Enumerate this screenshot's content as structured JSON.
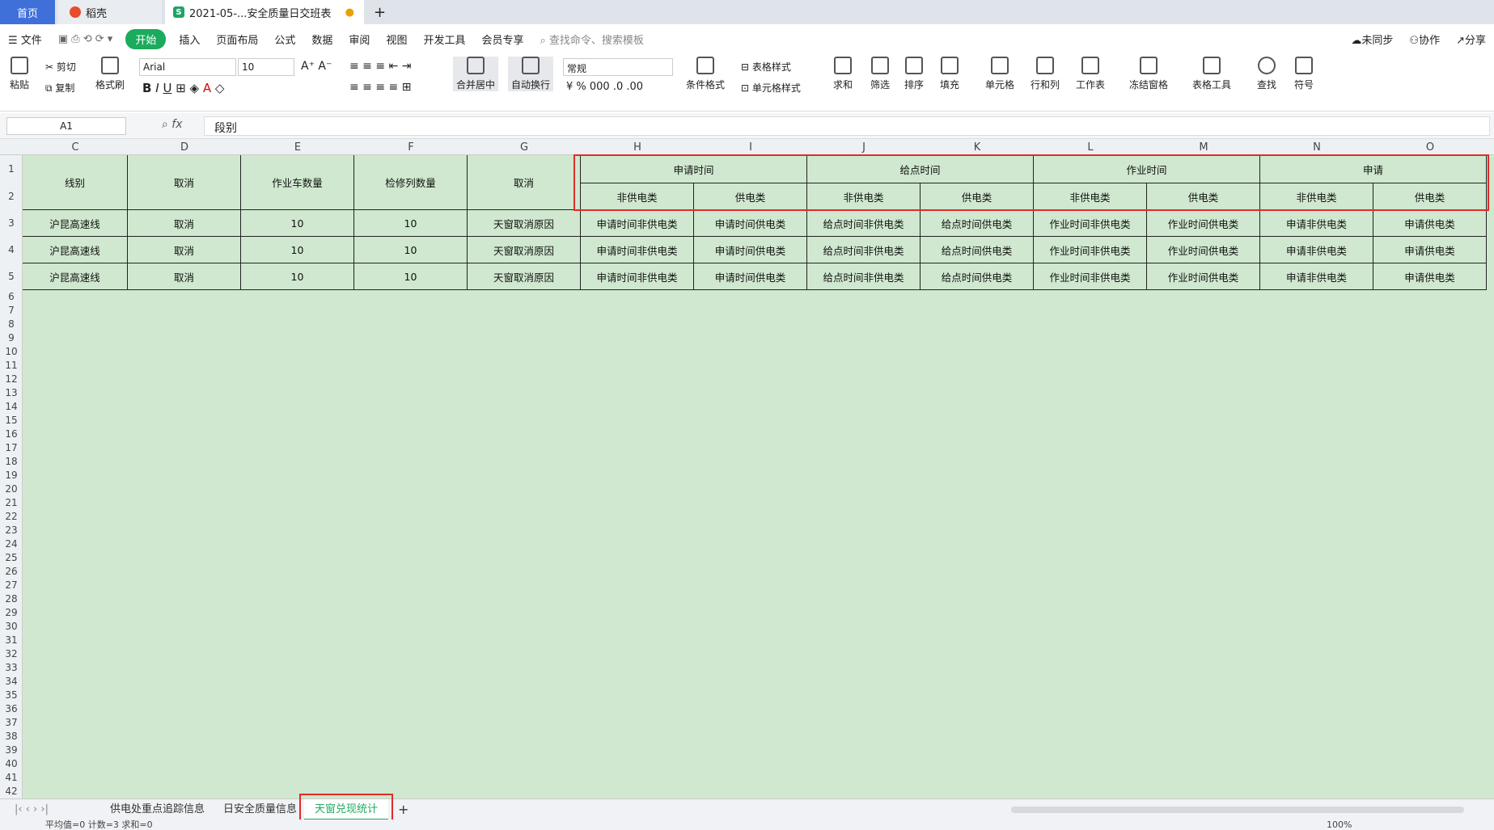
{
  "titlebar": {
    "home": "首页",
    "daoke": "稻壳",
    "doc": "2021-05-...安全质量日交班表"
  },
  "menu": {
    "file": "文件",
    "kaishi": "开始",
    "insert": "插入",
    "layout": "页面布局",
    "formula": "公式",
    "data": "数据",
    "review": "审阅",
    "view": "视图",
    "dev": "开发工具",
    "member": "会员专享",
    "search": "查找命令、搜索模板",
    "sync": "未同步",
    "collab": "协作",
    "share": "分享"
  },
  "ribbon": {
    "paste": "粘贴",
    "cut": "剪切",
    "copy": "复制",
    "format_painter": "格式刷",
    "font": "Arial",
    "size": "10",
    "merge": "合并居中",
    "wrap": "自动换行",
    "numfmt": "常规",
    "cond": "条件格式",
    "table_style": "表格样式",
    "cell_style": "单元格样式",
    "sum": "求和",
    "filter": "筛选",
    "sort": "排序",
    "fill": "填充",
    "cell": "单元格",
    "rowcol": "行和列",
    "sheet": "工作表",
    "freeze": "冻结窗格",
    "tools": "表格工具",
    "find": "查找",
    "symbol": "符号"
  },
  "formula": {
    "namebox": "A1",
    "fx": "fx",
    "value": "段别"
  },
  "columns": [
    "C",
    "D",
    "E",
    "F",
    "G",
    "H",
    "I",
    "J",
    "K",
    "L",
    "M",
    "N",
    "O"
  ],
  "rows": [
    "1",
    "2",
    "3",
    "4",
    "5",
    "6",
    "7",
    "8",
    "9",
    "10",
    "11",
    "12",
    "13",
    "14",
    "15",
    "16",
    "17",
    "18",
    "19",
    "20",
    "21",
    "22",
    "23",
    "24",
    "25",
    "26",
    "27",
    "28",
    "29",
    "30",
    "31",
    "32",
    "33",
    "34",
    "35",
    "36",
    "37",
    "38",
    "39",
    "40",
    "41",
    "42"
  ],
  "headers": {
    "c": "线别",
    "d": "取消",
    "e": "作业车数量",
    "f": "检修列数量",
    "g": "取消",
    "h1": "申请时间",
    "j1": "给点时间",
    "l1": "作业时间",
    "n1": "申请",
    "fei": "非供电类",
    "gong": "供电类"
  },
  "data_rows": [
    [
      "沪昆高速线",
      "取消",
      "10",
      "10",
      "天窗取消原因",
      "申请时间非供电类",
      "申请时间供电类",
      "给点时间非供电类",
      "给点时间供电类",
      "作业时间非供电类",
      "作业时间供电类",
      "申请非供电类",
      "申请供电类"
    ],
    [
      "沪昆高速线",
      "取消",
      "10",
      "10",
      "天窗取消原因",
      "申请时间非供电类",
      "申请时间供电类",
      "给点时间非供电类",
      "给点时间供电类",
      "作业时间非供电类",
      "作业时间供电类",
      "申请非供电类",
      "申请供电类"
    ],
    [
      "沪昆高速线",
      "取消",
      "10",
      "10",
      "天窗取消原因",
      "申请时间非供电类",
      "申请时间供电类",
      "给点时间非供电类",
      "给点时间供电类",
      "作业时间非供电类",
      "作业时间供电类",
      "申请非供电类",
      "申请供电类"
    ]
  ],
  "sheets": {
    "s1": "供电处重点追踪信息",
    "s2": "日安全质量信息",
    "s3": "天窗兑现统计",
    "add": "+"
  },
  "status": {
    "text": "平均值=0  计数=3  求和=0",
    "zoom": "100%"
  }
}
